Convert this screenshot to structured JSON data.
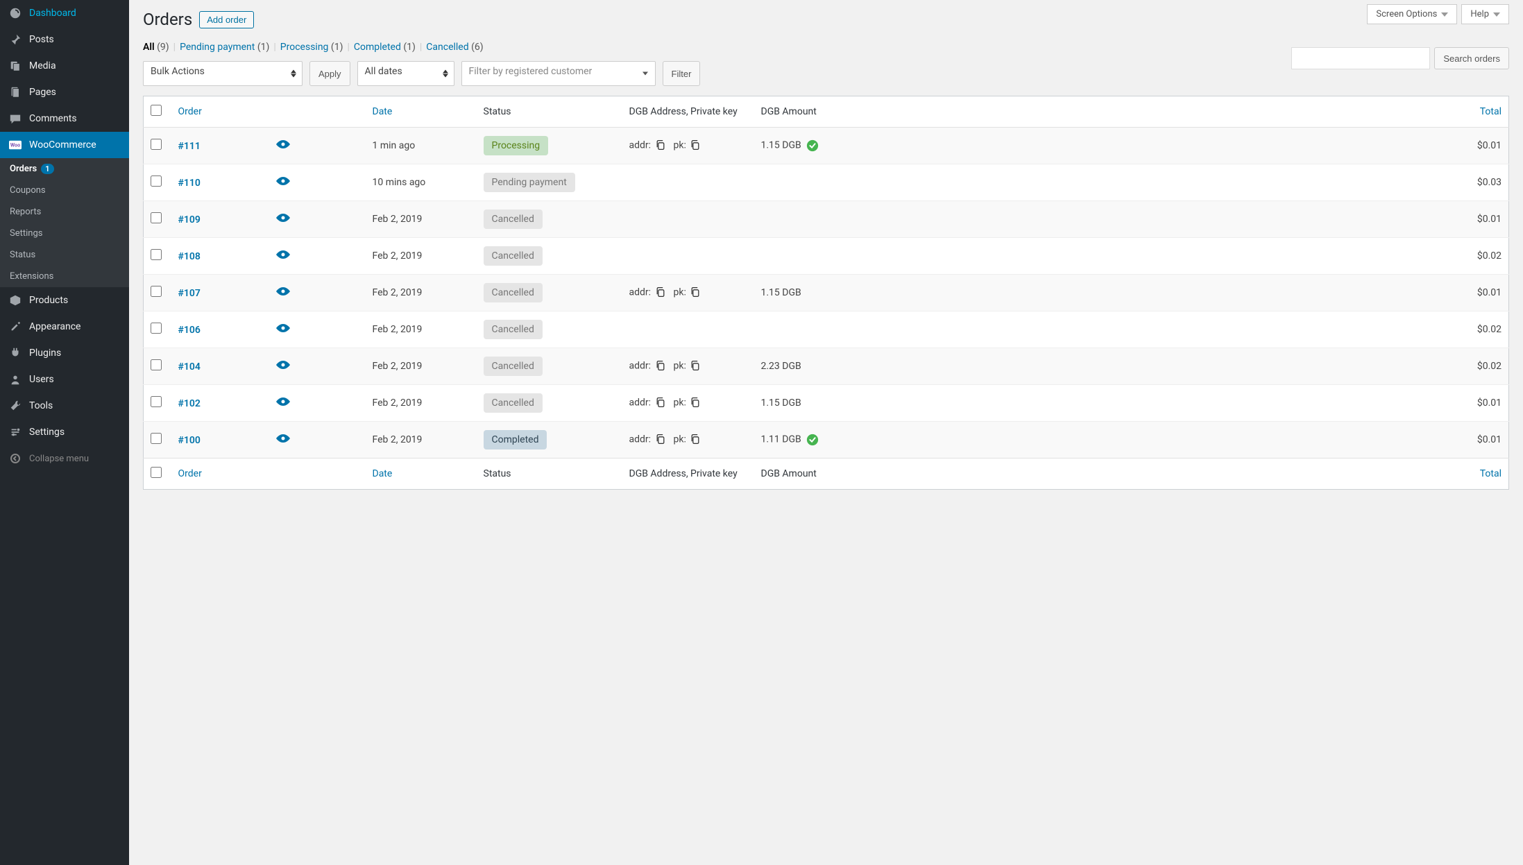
{
  "top_tabs": {
    "screen_options": "Screen Options",
    "help": "Help"
  },
  "sidebar": {
    "items": [
      {
        "label": "Dashboard",
        "icon": "dashboard-icon"
      },
      {
        "label": "Posts",
        "icon": "pin-icon"
      },
      {
        "label": "Media",
        "icon": "media-icon"
      },
      {
        "label": "Pages",
        "icon": "pages-icon"
      },
      {
        "label": "Comments",
        "icon": "comments-icon"
      },
      {
        "label": "WooCommerce",
        "icon": "woo-icon"
      },
      {
        "label": "Products",
        "icon": "products-icon"
      },
      {
        "label": "Appearance",
        "icon": "appearance-icon"
      },
      {
        "label": "Plugins",
        "icon": "plugins-icon"
      },
      {
        "label": "Users",
        "icon": "users-icon"
      },
      {
        "label": "Tools",
        "icon": "tools-icon"
      },
      {
        "label": "Settings",
        "icon": "settings-icon"
      }
    ],
    "woo_sub": [
      {
        "label": "Orders",
        "badge": "1"
      },
      {
        "label": "Coupons"
      },
      {
        "label": "Reports"
      },
      {
        "label": "Settings"
      },
      {
        "label": "Status"
      },
      {
        "label": "Extensions"
      }
    ],
    "collapse": "Collapse menu"
  },
  "page": {
    "title": "Orders",
    "add_button": "Add order"
  },
  "search": {
    "button": "Search orders",
    "placeholder": ""
  },
  "filters": {
    "statuses": [
      {
        "label": "All",
        "count": "(9)",
        "current": true
      },
      {
        "label": "Pending payment",
        "count": "(1)"
      },
      {
        "label": "Processing",
        "count": "(1)"
      },
      {
        "label": "Completed",
        "count": "(1)"
      },
      {
        "label": "Cancelled",
        "count": "(6)"
      }
    ],
    "bulk_label": "Bulk Actions",
    "apply": "Apply",
    "dates_label": "All dates",
    "customer_placeholder": "Filter by registered customer",
    "filter": "Filter"
  },
  "table": {
    "headers": {
      "order": "Order",
      "date": "Date",
      "status": "Status",
      "addr": "DGB Address, Private key",
      "amount": "DGB Amount",
      "total": "Total"
    },
    "addr_labels": {
      "addr": "addr:",
      "pk": "pk:"
    },
    "rows": [
      {
        "order": "#111",
        "date": "1 min ago",
        "status": "Processing",
        "status_class": "processing",
        "has_addr": true,
        "amount": "1.15 DGB",
        "verified": true,
        "total": "$0.01"
      },
      {
        "order": "#110",
        "date": "10 mins ago",
        "status": "Pending payment",
        "status_class": "pending",
        "has_addr": false,
        "amount": "",
        "verified": false,
        "total": "$0.03"
      },
      {
        "order": "#109",
        "date": "Feb 2, 2019",
        "status": "Cancelled",
        "status_class": "cancelled",
        "has_addr": false,
        "amount": "",
        "verified": false,
        "total": "$0.01"
      },
      {
        "order": "#108",
        "date": "Feb 2, 2019",
        "status": "Cancelled",
        "status_class": "cancelled",
        "has_addr": false,
        "amount": "",
        "verified": false,
        "total": "$0.02"
      },
      {
        "order": "#107",
        "date": "Feb 2, 2019",
        "status": "Cancelled",
        "status_class": "cancelled",
        "has_addr": true,
        "amount": "1.15 DGB",
        "verified": false,
        "total": "$0.01"
      },
      {
        "order": "#106",
        "date": "Feb 2, 2019",
        "status": "Cancelled",
        "status_class": "cancelled",
        "has_addr": false,
        "amount": "",
        "verified": false,
        "total": "$0.02"
      },
      {
        "order": "#104",
        "date": "Feb 2, 2019",
        "status": "Cancelled",
        "status_class": "cancelled",
        "has_addr": true,
        "amount": "2.23 DGB",
        "verified": false,
        "total": "$0.02"
      },
      {
        "order": "#102",
        "date": "Feb 2, 2019",
        "status": "Cancelled",
        "status_class": "cancelled",
        "has_addr": true,
        "amount": "1.15 DGB",
        "verified": false,
        "total": "$0.01"
      },
      {
        "order": "#100",
        "date": "Feb 2, 2019",
        "status": "Completed",
        "status_class": "completed",
        "has_addr": true,
        "amount": "1.11 DGB",
        "verified": true,
        "total": "$0.01"
      }
    ]
  }
}
